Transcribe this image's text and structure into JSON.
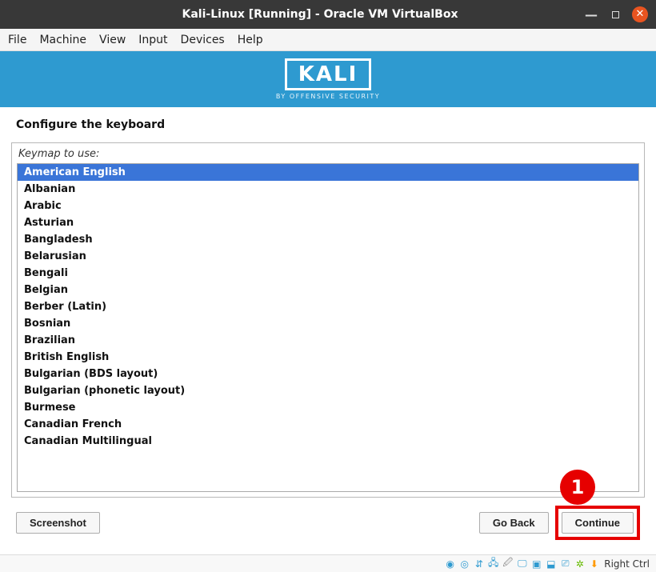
{
  "window": {
    "title": "Kali-Linux [Running] - Oracle VM VirtualBox"
  },
  "menu": {
    "items": [
      "File",
      "Machine",
      "View",
      "Input",
      "Devices",
      "Help"
    ]
  },
  "banner": {
    "logo_text": "KALI",
    "tagline": "BY OFFENSIVE SECURITY"
  },
  "installer": {
    "section_title": "Configure the keyboard",
    "list_label": "Keymap to use:",
    "selected_index": 0,
    "keymaps": [
      "American English",
      "Albanian",
      "Arabic",
      "Asturian",
      "Bangladesh",
      "Belarusian",
      "Bengali",
      "Belgian",
      "Berber (Latin)",
      "Bosnian",
      "Brazilian",
      "British English",
      "Bulgarian (BDS layout)",
      "Bulgarian (phonetic layout)",
      "Burmese",
      "Canadian French",
      "Canadian Multilingual"
    ],
    "buttons": {
      "screenshot": "Screenshot",
      "goback": "Go Back",
      "continue": "Continue"
    }
  },
  "statusbar": {
    "hostkey": "Right Ctrl"
  },
  "annotation": {
    "callout_number": "1"
  },
  "colors": {
    "banner": "#2e9ad0",
    "selection": "#3a75d8",
    "titlebar": "#383838",
    "highlight": "#e60000",
    "close_btn": "#e95420"
  }
}
